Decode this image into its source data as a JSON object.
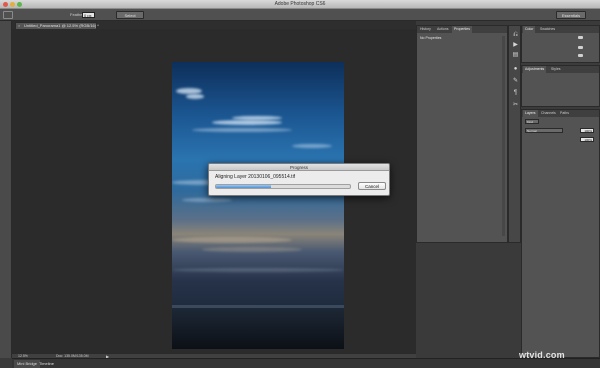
{
  "window": {
    "title": "Adobe Photoshop CS6",
    "traffic_lights": [
      "#e05a4a",
      "#e0b040",
      "#5ab84a"
    ]
  },
  "options_bar": {
    "feather_label": "Feather:",
    "feather_value": "0 px",
    "select_button": "Select Subject...",
    "workspace": "Essentials"
  },
  "document": {
    "tab_close": "×",
    "tab_label": "Untitled_Panorama1 @ 12.5% (RGB/16) *"
  },
  "status_bar": {
    "zoom": "12.5%",
    "doc_size": "Doc: 135.0M/135.0M",
    "arrow": "▶"
  },
  "bottom_tabs": [
    "Mini Bridge",
    "Timeline"
  ],
  "properties_panel": {
    "tabs": [
      "History",
      "Actions",
      "Properties"
    ],
    "active_tab": "Properties",
    "message": "No Properties"
  },
  "right_panels": {
    "color": {
      "tabs": [
        "Color",
        "Swatches"
      ]
    },
    "adjustments": {
      "tabs": [
        "Adjustments",
        "Styles"
      ]
    },
    "layers": {
      "tabs": [
        "Layers",
        "Channels",
        "Paths"
      ],
      "kind": "Kind",
      "blend": "Normal",
      "opacity": "100%",
      "fill": "100%"
    }
  },
  "progress_dialog": {
    "title": "Progress",
    "message": "Aligning Layer 20130106_095514.tif",
    "progress": 0.41,
    "cancel_label": "Cancel"
  },
  "watermark": "wtvid.com"
}
